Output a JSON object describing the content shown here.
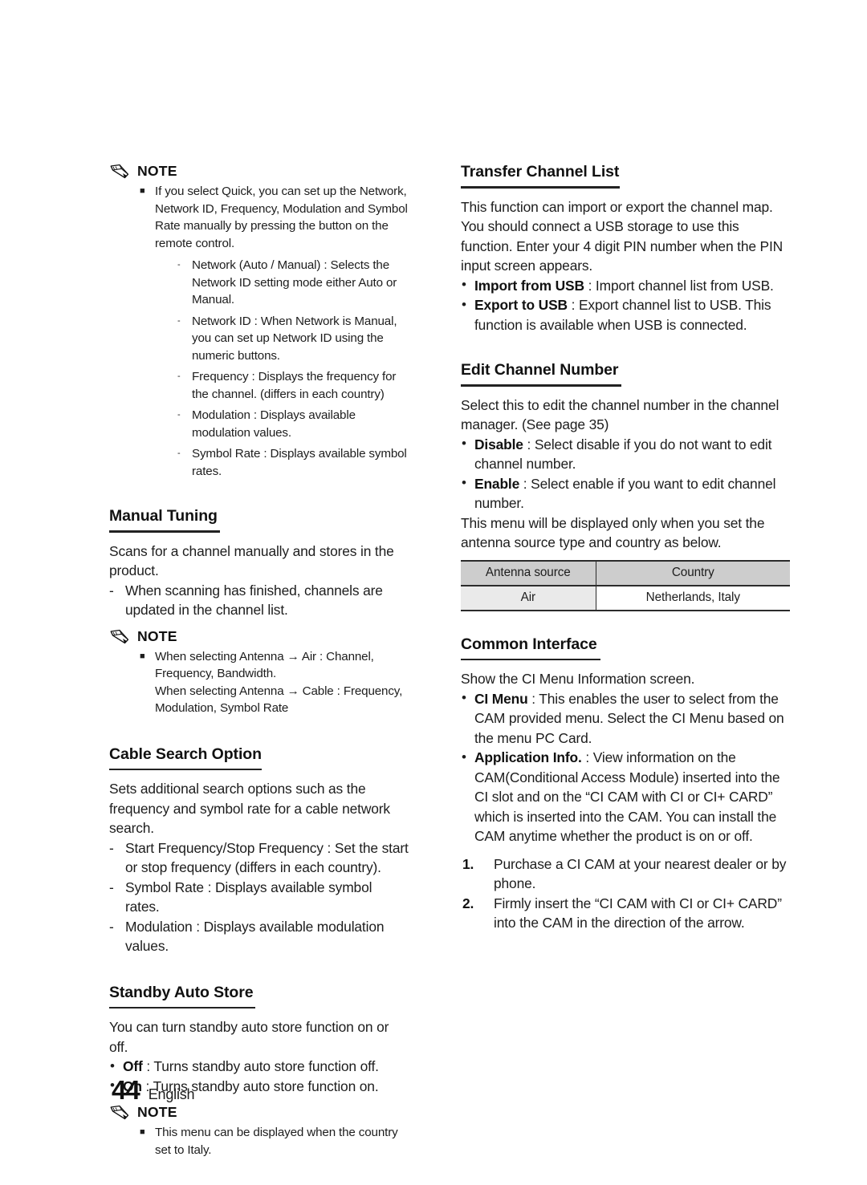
{
  "footer": {
    "page_number": "44",
    "language": "English"
  },
  "note_label": "NOTE",
  "left_column": {
    "note_quick": {
      "items": [
        "If you select Quick, you can set up the Network, Network ID, Frequency, Modulation and Symbol Rate manually by pressing the button on the remote control."
      ],
      "sub_items": [
        "Network (Auto / Manual) : Selects the Network ID setting mode either Auto or Manual.",
        "Network ID : When Network is Manual, you can set up Network ID using the numeric buttons.",
        "Frequency : Displays the frequency for the channel. (differs in each country)",
        "Modulation : Displays available modulation values.",
        "Symbol Rate : Displays available symbol rates."
      ]
    },
    "manual_tuning": {
      "heading": "Manual Tuning",
      "intro": "Scans for a channel manually and stores in the product.",
      "dash_items": [
        "When scanning has finished, channels are updated in the channel list."
      ],
      "note_items": [
        "When selecting Antenna → Air : Channel, Frequency, Bandwidth.",
        "When selecting Antenna → Cable : Frequency, Modulation, Symbol Rate"
      ]
    },
    "cable_search_option": {
      "heading": "Cable Search Option",
      "intro": "Sets additional search options such as the frequency and symbol rate for a cable network search.",
      "dash_items": [
        "Start Frequency/Stop Frequency : Set the start or stop frequency (differs in each country).",
        "Symbol Rate : Displays available symbol rates.",
        "Modulation : Displays available modulation values."
      ]
    },
    "standby_auto_store": {
      "heading": "Standby Auto Store",
      "intro": "You can turn standby auto store function on or off.",
      "bullets": [
        {
          "label": "Off",
          "text": " : Turns standby auto store function off."
        },
        {
          "label": "On",
          "text": " : Turns standby auto store function on."
        }
      ],
      "note_items": [
        "This menu can be displayed when the country set to Italy."
      ]
    }
  },
  "right_column": {
    "transfer_channel_list": {
      "heading": "Transfer Channel List",
      "intro": "This function can import or export the channel map. You should connect a USB storage to use this function. Enter your 4 digit PIN number when the PIN input screen appears.",
      "bullets": [
        {
          "label": "Import from USB",
          "text": " : Import channel list from USB."
        },
        {
          "label": "Export to USB",
          "text": " : Export channel list to USB. This function is available when USB is connected."
        }
      ]
    },
    "edit_channel_number": {
      "heading": "Edit Channel Number",
      "intro": "Select this to edit the channel number in the channel manager. (See page 35)",
      "bullets": [
        {
          "label": "Disable",
          "text": " : Select disable if you do not want to edit channel number."
        },
        {
          "label": "Enable",
          "text": " : Select enable if you want to edit channel number."
        }
      ],
      "outro": "This menu will be displayed only when you set the antenna source type and country as below.",
      "table": {
        "headers": [
          "Antenna source",
          "Country"
        ],
        "rows": [
          [
            "Air",
            "Netherlands, Italy"
          ]
        ]
      }
    },
    "common_interface": {
      "heading": "Common Interface",
      "intro": "Show the CI Menu Information screen.",
      "bullets": [
        {
          "label": "CI Menu",
          "text": " : This enables the user to select from the CAM provided menu. Select the CI Menu based on the menu PC Card."
        },
        {
          "label": "Application Info.",
          "text": " : View information on the CAM(Conditional Access Module) inserted into the CI slot and on the “CI CAM with CI or CI+ CARD” which is inserted into the CAM. You can install the CAM anytime whether the product is on or off."
        }
      ],
      "steps": [
        {
          "num": "1.",
          "text": "Purchase a CI CAM at your nearest dealer or by phone."
        },
        {
          "num": "2.",
          "text": "Firmly insert the “CI CAM with CI or CI+ CARD” into the CAM in the direction of the arrow."
        }
      ]
    }
  }
}
